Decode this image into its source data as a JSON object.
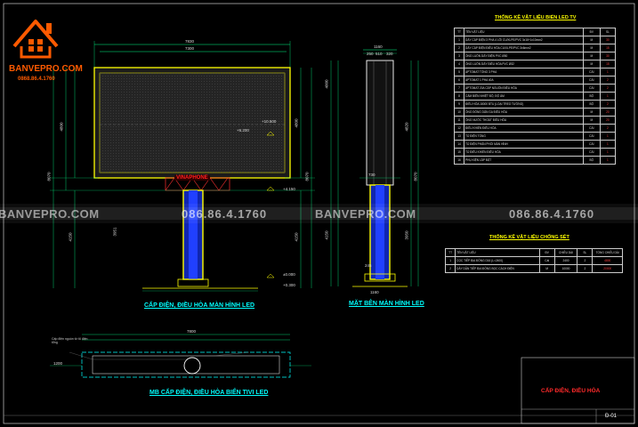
{
  "logo": {
    "brand": "BANVEPRO.COM",
    "phone": "0868.86.4.1760"
  },
  "watermarks": {
    "site_left": "BANVEPRO.COM",
    "phone_left": "086.86.4.1760",
    "site_right": "BANVEPRO.COM",
    "phone_right": "086.86.4.1760"
  },
  "captions": {
    "front": "CẤP ĐIỆN, ĐIỀU HÒA MÀN HÌNH LED",
    "side": "MẶT BÊN MÀN HÌNH LED",
    "plan": "MB CẤP ĐIỆN, ĐIỀU HÒA BIỂN TIVI LED"
  },
  "sign_text": "VINAPHONE",
  "dims": {
    "top_width": "7830",
    "inner_width": "7300",
    "side_width": "1160",
    "side_sub": [
      "250",
      "510",
      "320"
    ],
    "h_total": "8070",
    "h_screen": "4800",
    "h_pole": "4150",
    "h_base": "3951",
    "lvl_screen": "+6.200",
    "lvl_top": "+10.500",
    "lvl_sign": "+4.150",
    "lvl_base": "±0.000",
    "lvl_ground": "+0.300",
    "side_h1": "4000",
    "side_h2": "4820",
    "side_h3": "1620",
    "side_h4": "3950",
    "side_h5": "1000",
    "plan_len": "7800",
    "plan_dim": "1200",
    "bottom_d1": "730",
    "bottom_d2": "245",
    "pole_w": "750",
    "side_w2": "1160"
  },
  "bom_table": {
    "title": "THỐNG KÊ VẬT LIỆU BIỂN LED TV",
    "headers": [
      "TT",
      "TÊN VẬT LIỆU",
      "ĐV",
      "SL"
    ],
    "rows": [
      [
        "1",
        "DÂY CÁP ĐIỆN 3 PHA 4 LÕI CU/XLPE/PVC 3x16+1x10mm2",
        "M",
        "30"
      ],
      [
        "2",
        "DÂY CÁP ĐIỆN ĐIỀU HÒA CU/XLPE/PVC 3x6mm2",
        "M",
        "15"
      ],
      [
        "3",
        "ỐNG LUỒN DÂY ĐIỆN PVC Ø50",
        "M",
        "30"
      ],
      [
        "4",
        "ỐNG LUỒN DÂY ĐIỀU HÒA PVC Ø32",
        "M",
        "15"
      ],
      [
        "5",
        "APTOMAT TỔNG 3 PHA",
        "CÁI",
        "1"
      ],
      [
        "6",
        "APTOMAT 1 PHA 40A",
        "CÁI",
        "2"
      ],
      [
        "7",
        "APTOMAT 20A CẤP NGUỒN ĐIỀU HÒA",
        "CÁI",
        "2"
      ],
      [
        "8",
        "CẢM BIẾN NHIỆT ĐỘ, ĐỘ ẨM",
        "BỘ",
        "1"
      ],
      [
        "9",
        "ĐIỀU HÒA 18000 BTU (LOẠI TREO TƯỜNG)",
        "BỘ",
        "2"
      ],
      [
        "10",
        "ỐNG ĐỒNG DẪN GA ĐIỀU HÒA",
        "M",
        "20"
      ],
      [
        "11",
        "ỐNG NƯỚC THOÁT ĐIỀU HÒA",
        "M",
        "20"
      ],
      [
        "12",
        "ĐIỀU KHIỂN ĐIỀU HÒA",
        "CÁI",
        "2"
      ],
      [
        "13",
        "TỦ ĐIỆN TỔNG",
        "CÁI",
        "1"
      ],
      [
        "14",
        "TỦ ĐIỆN PHÂN PHỐI MÀN HÌNH",
        "CÁI",
        "1"
      ],
      [
        "15",
        "TỦ ĐIỀU KHIỂN ĐIỀU HÒA",
        "CÁI",
        "1"
      ],
      [
        "16",
        "PHỤ KIỆN LẮP ĐẶT",
        "BỘ",
        "1"
      ]
    ]
  },
  "lightning_table": {
    "title": "THỐNG KÊ VẬT LIỆU CHỐNG SÉT",
    "headers": [
      "TT",
      "TÊN VẬT LIỆU",
      "ĐV",
      "CHIỀU DÀI",
      "SL",
      "TỔNG CHIỀU DÀI"
    ],
    "rows": [
      [
        "1",
        "CỌC TIẾP ĐỊA ĐỒNG D16 (L=2400)",
        "Cái",
        "2400",
        "2",
        "4800"
      ],
      [
        "2",
        "DÂY DẪN TIẾP ĐỊA ĐỒNG BỌC CÁCH ĐIỆN",
        "M",
        "10000",
        "2",
        "20000"
      ]
    ]
  },
  "title_block": {
    "drawing_title": "CẤP ĐIỆN, ĐIỀU HÒA",
    "sheet_code": "Đ-01"
  },
  "plan_note": "Cấp điện nguồn từ tủ điện tổng"
}
